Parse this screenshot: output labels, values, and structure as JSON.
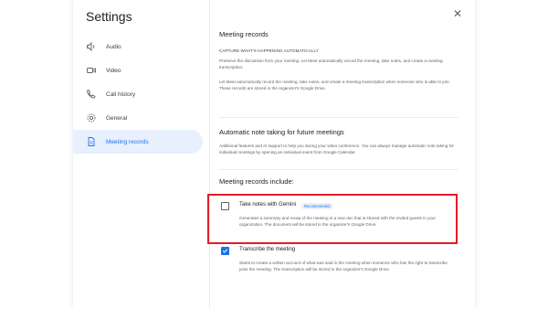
{
  "colors": {
    "accent": "#1a73e8",
    "highlight_border": "#e21b2a",
    "active_nav_bg": "#e8f0fe"
  },
  "sidebar": {
    "title": "Settings",
    "items": [
      {
        "label": "Audio",
        "icon": "speaker-icon"
      },
      {
        "label": "Video",
        "icon": "video-camera-icon"
      },
      {
        "label": "Call history",
        "icon": "phone-icon"
      },
      {
        "label": "General",
        "icon": "gear-icon"
      },
      {
        "label": "Meeting records",
        "icon": "document-icon",
        "active": true
      }
    ]
  },
  "close_icon": "close-icon",
  "content": {
    "section1_title": "Meeting records",
    "section1_caption": "CAPTURE WHAT'S HAPPENING AUTOMATICALLY",
    "section1_p1": "Preserve the discussion from your meeting. Let Meet automatically record the meeting, take notes, and create a meeting transcription.",
    "section1_p2": "Let Meet automatically record the meeting, take notes, and create a meeting transcription when someone who is able to join. These records are stored in the organizer's Google Drive.",
    "section2_title": "Automatic note taking for future meetings",
    "section2_p": "Additional features and AI support to help you during your video conference. You can always manage automatic note taking for individual meetings by opening an individual event from Google Calendar.",
    "include_title": "Meeting records include:",
    "options": [
      {
        "label": "Take notes with Gemini",
        "badge": "Recommended",
        "checked": false,
        "desc": "Generates a summary and recap of the meeting in a new doc that is shared with the invited guests in your organization. The document will be stored in the organizer's Google Drive."
      },
      {
        "label": "Transcribe the meeting",
        "checked": true,
        "desc": "Starts to create a written account of what was said in the meeting when someone who has the right to transcribe joins the meeting. The transcription will be stored in the organizer's Google Drive."
      }
    ]
  }
}
